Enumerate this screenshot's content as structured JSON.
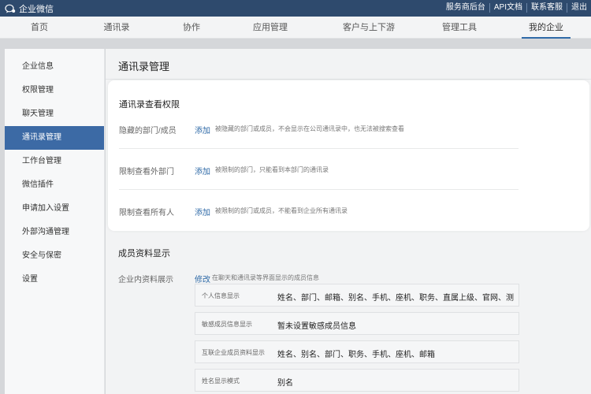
{
  "topbar": {
    "app_name": "企业微信",
    "links": [
      "服务商后台",
      "API文档",
      "联系客服",
      "退出"
    ]
  },
  "nav": {
    "items": [
      "首页",
      "通讯录",
      "协作",
      "应用管理",
      "客户与上下游",
      "管理工具",
      "我的企业"
    ],
    "active": "我的企业"
  },
  "sidebar": {
    "items": [
      "企业信息",
      "权限管理",
      "聊天管理",
      "通讯录管理",
      "工作台管理",
      "微信插件",
      "申请加入设置",
      "外部沟通管理",
      "安全与保密",
      "设置"
    ],
    "active": "通讯录管理"
  },
  "main": {
    "title": "通讯录管理",
    "view_permission": {
      "title": "通讯录查看权限",
      "rows": [
        {
          "label": "隐藏的部门/成员",
          "action": "添加",
          "desc": "被隐藏的部门或成员，不会显示在公司通讯录中，也无法被搜索查看"
        },
        {
          "label": "限制查看外部门",
          "action": "添加",
          "desc": "被限制的部门，只能看到本部门的通讯录"
        },
        {
          "label": "限制查看所有人",
          "action": "添加",
          "desc": "被限制的部门或成员，不能看到企业所有通讯录"
        }
      ]
    },
    "member_display": {
      "title": "成员资料显示",
      "label": "企业内资料展示",
      "action": "修改",
      "desc": "在聊天和通讯录等界面显示的成员信息",
      "boxes": [
        {
          "key": "个人信息显示",
          "value": "姓名、部门、邮箱、别名、手机、座机、职务、直属上级、官网、测..."
        },
        {
          "key": "敏感成员信息显示",
          "value": "暂未设置敏感成员信息"
        },
        {
          "key": "互联企业成员资料显示",
          "value": "姓名、别名、部门、职务、手机、座机、邮箱"
        },
        {
          "key": "姓名显示模式",
          "value": "别名"
        }
      ]
    }
  }
}
